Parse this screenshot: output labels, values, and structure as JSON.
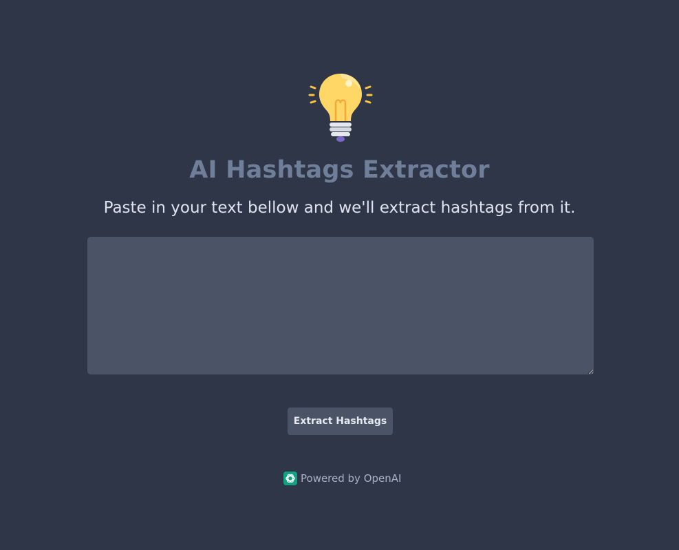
{
  "header": {
    "icon": "lightbulb-icon",
    "title": "AI Hashtags Extractor",
    "subtitle": "Paste in your text bellow and we'll extract hashtags from it."
  },
  "input": {
    "value": "",
    "placeholder": ""
  },
  "actions": {
    "extract_label": "Extract Hashtags"
  },
  "footer": {
    "icon": "openai-icon",
    "powered_by": "Powered by OpenAI"
  },
  "colors": {
    "background": "#2e3647",
    "title": "#6f7f99",
    "subtitle": "#dde4ef",
    "input_background": "#4a5466",
    "button_background": "#4a5466",
    "footer_text": "#a8b3c5",
    "openai_green": "#10a37f"
  }
}
